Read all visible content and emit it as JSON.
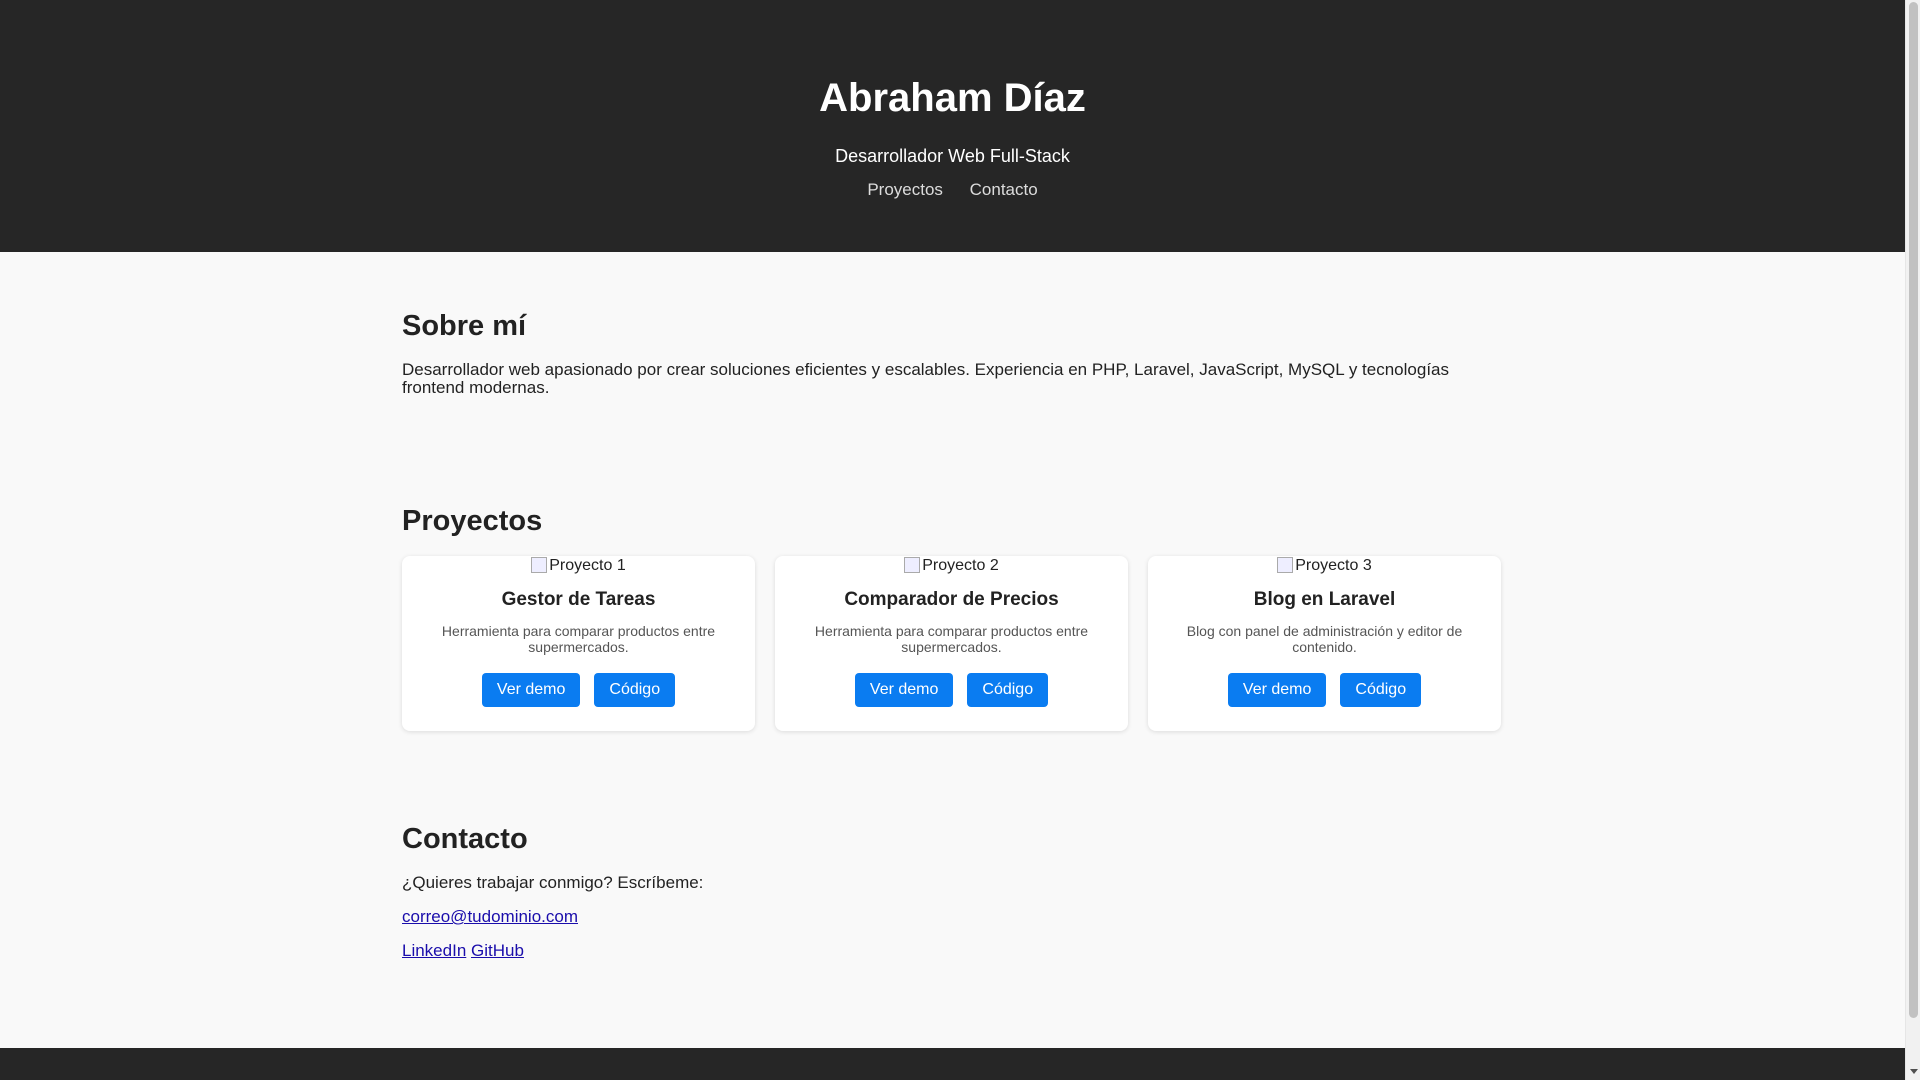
{
  "header": {
    "name": "Abraham Díaz",
    "role": "Desarrollador Web Full-Stack",
    "nav": [
      {
        "label": "Proyectos"
      },
      {
        "label": "Contacto"
      }
    ]
  },
  "about": {
    "heading": "Sobre mí",
    "text": "Desarrollador web apasionado por crear soluciones eficientes y escalables. Experiencia en PHP, Laravel, JavaScript, MySQL y tecnologías frontend modernas."
  },
  "projects": {
    "heading": "Proyectos",
    "items": [
      {
        "image_alt": "Proyecto 1",
        "title": "Gestor de Tareas",
        "description": "Herramienta para comparar productos entre supermercados.",
        "demo_label": "Ver demo",
        "code_label": "Código"
      },
      {
        "image_alt": "Proyecto 2",
        "title": "Comparador de Precios",
        "description": "Herramienta para comparar productos entre supermercados.",
        "demo_label": "Ver demo",
        "code_label": "Código"
      },
      {
        "image_alt": "Proyecto 3",
        "title": "Blog en Laravel",
        "description": "Blog con panel de administración y editor de contenido.",
        "demo_label": "Ver demo",
        "code_label": "Código"
      }
    ]
  },
  "contact": {
    "heading": "Contacto",
    "intro": "¿Quieres trabajar conmigo? Escríbeme:",
    "email": "correo@tudominio.com",
    "linkedin": "LinkedIn",
    "github": "GitHub"
  },
  "colors": {
    "header_bg": "#262626",
    "button_bg": "#0a7cf1",
    "link": "#1a0dab"
  }
}
